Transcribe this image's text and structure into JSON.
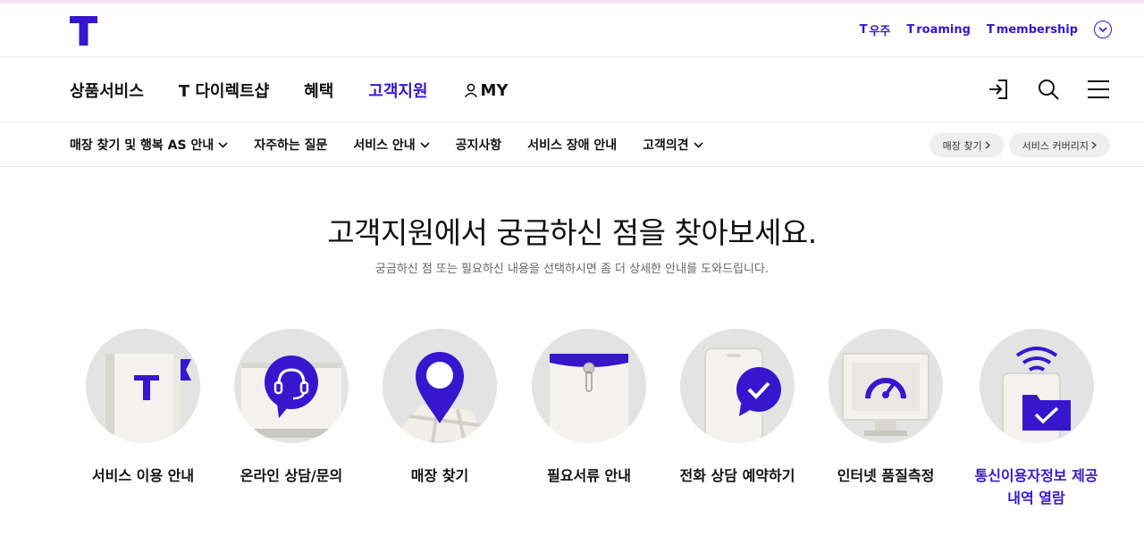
{
  "header": {
    "util_links": [
      {
        "t": "T",
        "label": "우주"
      },
      {
        "t": "T",
        "label": "roaming"
      },
      {
        "t": "T",
        "label": "membership"
      }
    ]
  },
  "gnb": {
    "items": [
      {
        "label": "상품서비스",
        "active": false
      },
      {
        "label": "T 다이렉트샵",
        "active": false
      },
      {
        "label": "혜택",
        "active": false
      },
      {
        "label": "고객지원",
        "active": true
      },
      {
        "label": "MY",
        "active": false
      }
    ]
  },
  "lnb": {
    "items": [
      {
        "label": "매장 찾기 및 행복 AS 안내",
        "dropdown": true
      },
      {
        "label": "자주하는 질문",
        "dropdown": false
      },
      {
        "label": "서비스 안내",
        "dropdown": true
      },
      {
        "label": "공지사항",
        "dropdown": false
      },
      {
        "label": "서비스 장애 안내",
        "dropdown": false
      },
      {
        "label": "고객의견",
        "dropdown": true
      }
    ],
    "pills": [
      "매장 찾기",
      "서비스 커버리지"
    ]
  },
  "hero": {
    "title": "고객지원에서 궁금하신 점을 찾아보세요.",
    "subtitle": "궁금하신 점 또는 필요하신 내용을 선택하시면 좀 더 상세한 안내를 도와드립니다."
  },
  "services": [
    {
      "label": "서비스 이용 안내",
      "icon": "book-icon"
    },
    {
      "label": "온라인 상담/문의",
      "icon": "headset-chat-icon"
    },
    {
      "label": "매장 찾기",
      "icon": "map-pin-icon"
    },
    {
      "label": "필요서류 안내",
      "icon": "document-envelope-icon"
    },
    {
      "label": "전화 상담 예약하기",
      "icon": "phone-check-icon"
    },
    {
      "label": "인터넷 품질측정",
      "icon": "speed-gauge-monitor-icon"
    },
    {
      "label": "통신이용자정보 제공 내역 열람",
      "line1": "통신이용자정보 제공",
      "line2": "내역 열람",
      "icon": "wifi-folder-icon"
    }
  ],
  "colors": {
    "brand": "#3617ce",
    "circle_bg": "#e3e3e3"
  }
}
